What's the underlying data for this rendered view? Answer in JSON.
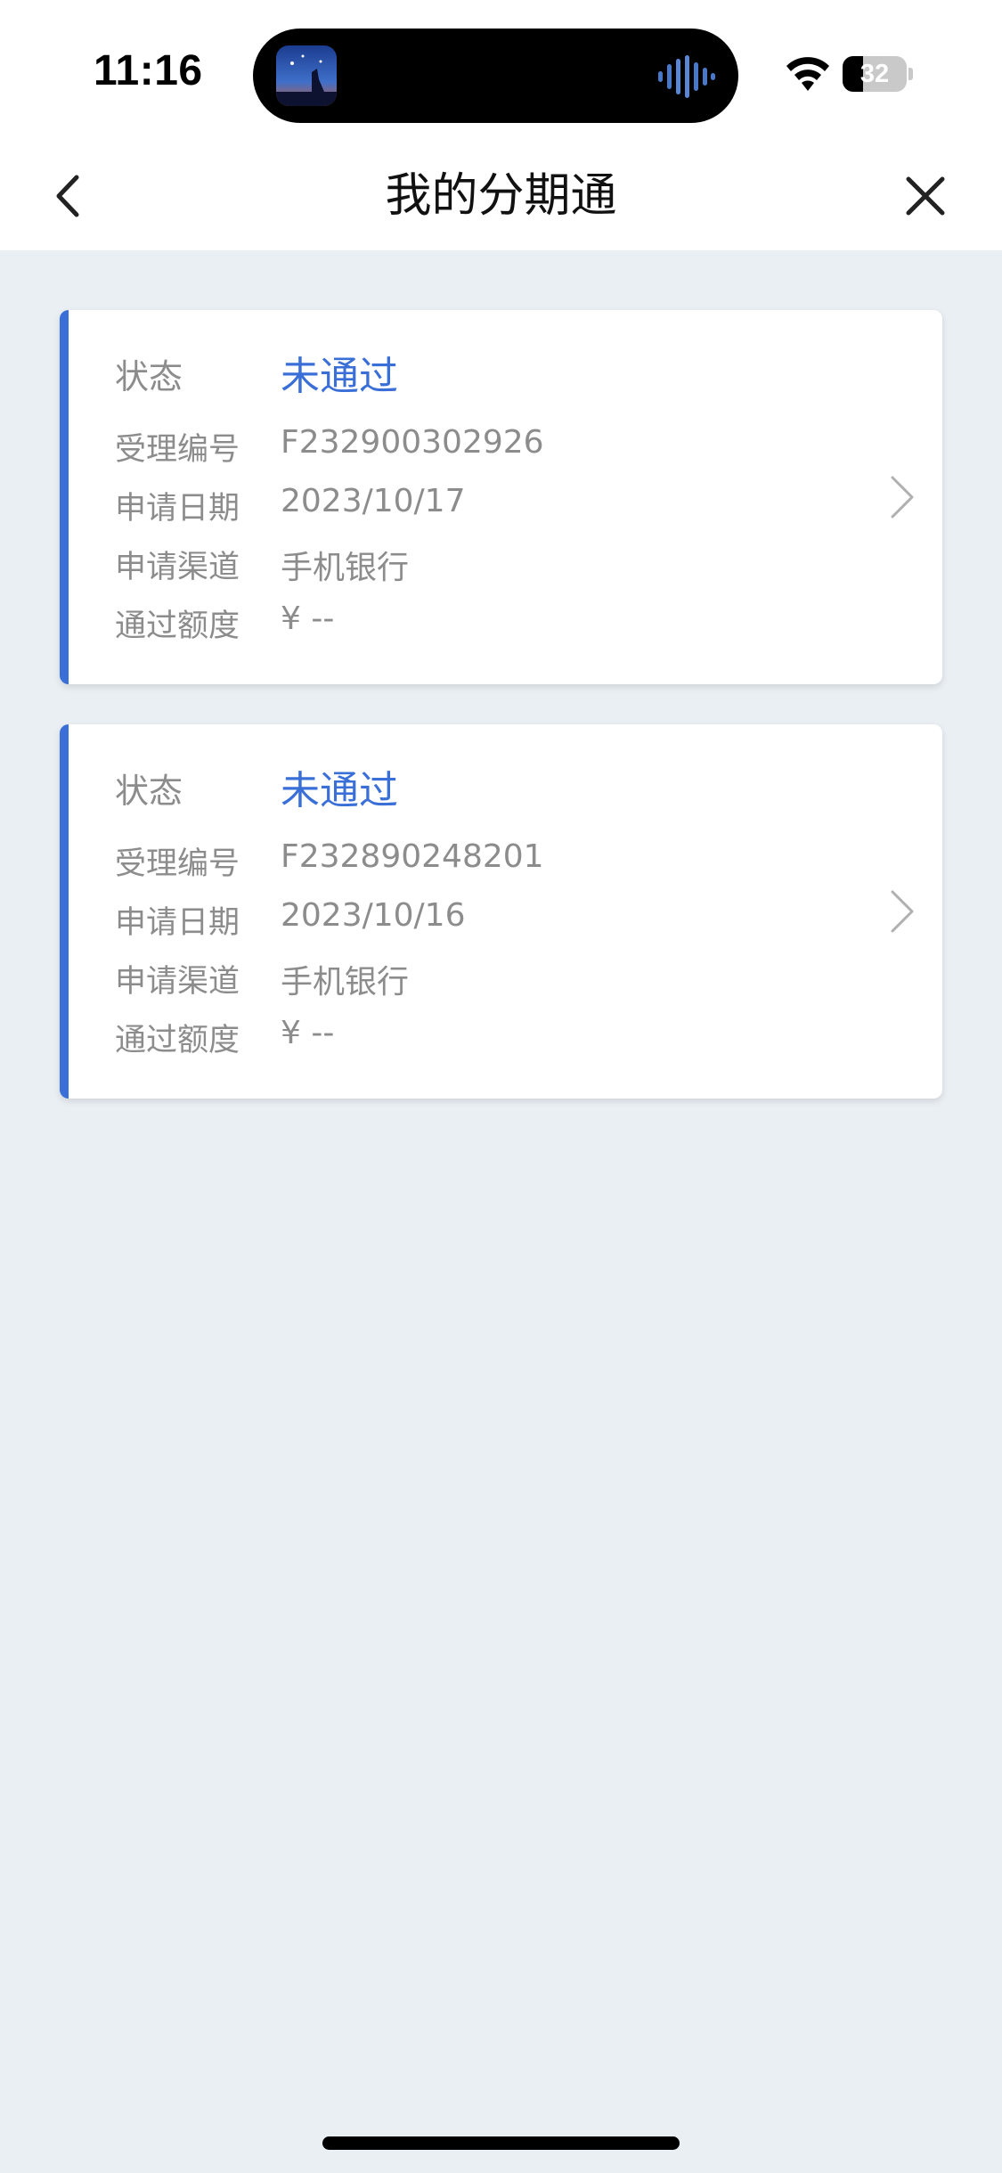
{
  "status_bar": {
    "time": "11:16",
    "battery_level": "32",
    "battery_fraction": 0.32,
    "icons": [
      "now-playing-artwork",
      "audio-waveform-icon",
      "wifi-icon",
      "battery-icon"
    ]
  },
  "nav": {
    "title": "我的分期通",
    "back_icon": "chevron-left-icon",
    "close_icon": "close-icon"
  },
  "applications": [
    {
      "status_label": "状态",
      "status_value": "未通过",
      "fields": [
        {
          "label": "受理编号",
          "value": "F232900302926"
        },
        {
          "label": "申请日期",
          "value": "2023/10/17"
        },
        {
          "label": "申请渠道",
          "value": "手机银行"
        },
        {
          "label": "通过额度",
          "value": "¥ --"
        }
      ]
    },
    {
      "status_label": "状态",
      "status_value": "未通过",
      "fields": [
        {
          "label": "受理编号",
          "value": "F232890248201"
        },
        {
          "label": "申请日期",
          "value": "2023/10/16"
        },
        {
          "label": "申请渠道",
          "value": "手机银行"
        },
        {
          "label": "通过额度",
          "value": "¥ --"
        }
      ]
    }
  ],
  "colors": {
    "accent": "#3a6fd8",
    "background": "#eaeff4",
    "label_gray": "#8c8c8c"
  }
}
